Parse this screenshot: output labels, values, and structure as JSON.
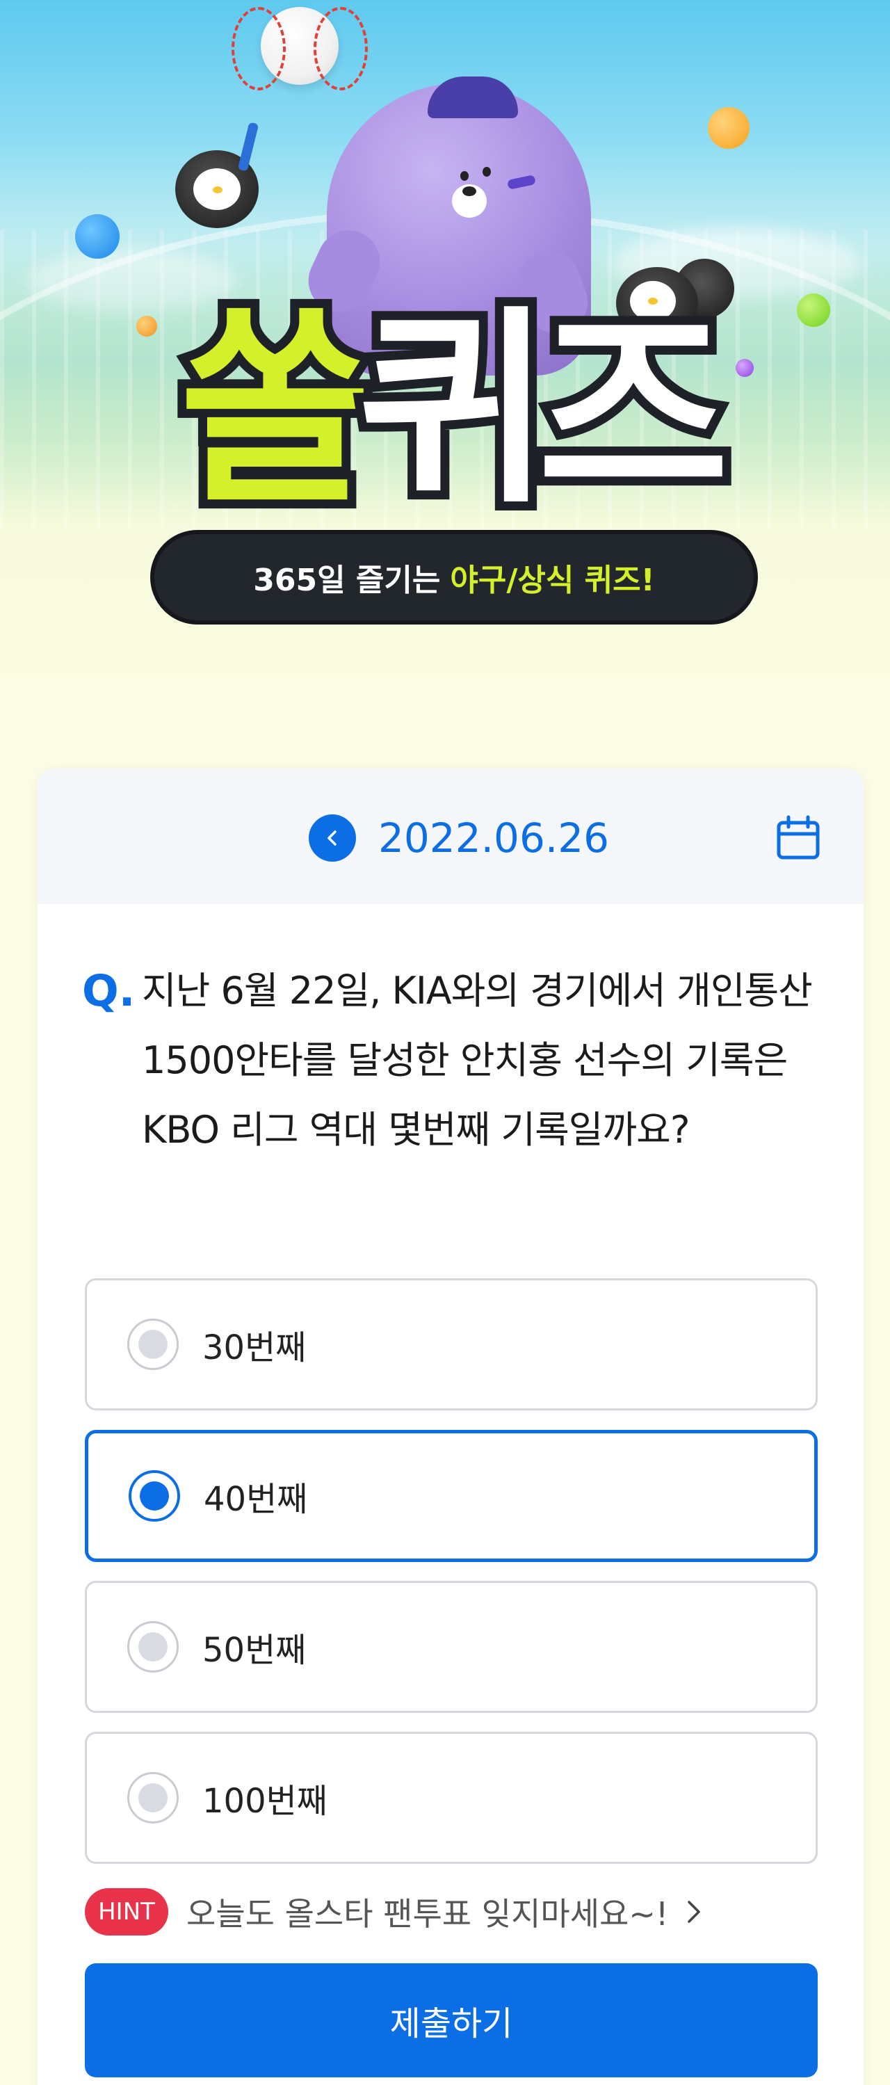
{
  "hero": {
    "title_part1": "쏠",
    "title_part2": "퀴즈",
    "subtitle_white": "365일 즐기는",
    "subtitle_highlight": "야구/상식 퀴즈!"
  },
  "date_nav": {
    "date": "2022.06.26",
    "prev_icon": "chevron-left-icon",
    "calendar_icon": "calendar-icon"
  },
  "question": {
    "prefix": "Q.",
    "text": "지난 6월 22일, KIA와의 경기에서 개인통산 1500안타를 달성한 안치홍 선수의 기록은 KBO 리그 역대 몇번째 기록일까요?"
  },
  "options": [
    {
      "label": "30번째",
      "selected": false
    },
    {
      "label": "40번째",
      "selected": true
    },
    {
      "label": "50번째",
      "selected": false
    },
    {
      "label": "100번째",
      "selected": false
    }
  ],
  "hint": {
    "badge": "HINT",
    "text": "오늘도 올스타 팬투표 잊지마세요~!"
  },
  "submit": {
    "label": "제출하기"
  },
  "colors": {
    "primary": "#0b6ee5",
    "hint_badge": "#e8334a",
    "title_green": "#d4f02a",
    "dark": "#22262d"
  }
}
